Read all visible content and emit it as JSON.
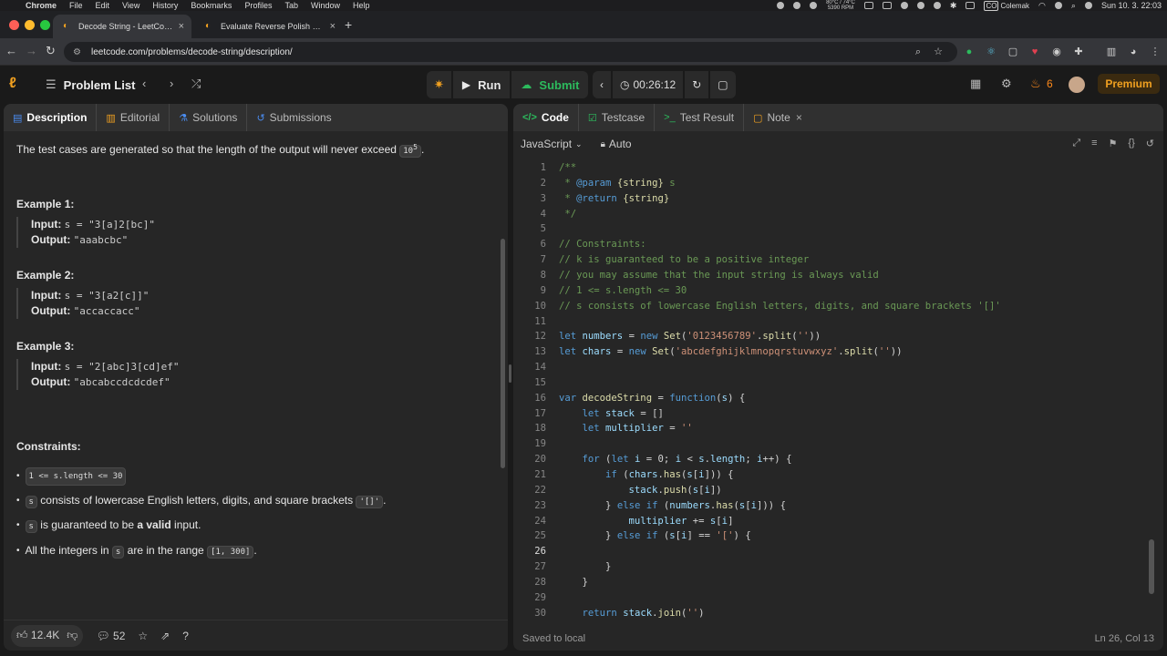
{
  "menubar": {
    "app": "Chrome",
    "items": [
      "File",
      "Edit",
      "View",
      "History",
      "Bookmarks",
      "Profiles",
      "Tab",
      "Window",
      "Help"
    ],
    "cpu_text": "80°C / 74°C",
    "fan_text": "5390 RPM",
    "keyboard": "Colemak",
    "clock": "Sun 10. 3.  22:03"
  },
  "tabs": [
    {
      "title": "Decode String - LeetCode",
      "active": true
    },
    {
      "title": "Evaluate Reverse Polish Notat",
      "active": false
    }
  ],
  "address": {
    "url": "leetcode.com/problems/decode-string/description/"
  },
  "header": {
    "problem_list": "Problem List",
    "run_label": "Run",
    "submit_label": "Submit",
    "timer": "00:26:12",
    "streak": "6",
    "premium": "Premium"
  },
  "left_tabs": [
    "Description",
    "Editorial",
    "Solutions",
    "Submissions"
  ],
  "description": {
    "intro_pre": "The test cases are generated so that the length of the output will never exceed ",
    "intro_code": "10",
    "intro_sup": "5",
    "intro_post": ".",
    "examples": [
      {
        "title": "Example 1:",
        "input": "s = \"3[a]2[bc]\"",
        "output": "\"aaabcbc\""
      },
      {
        "title": "Example 2:",
        "input": "s = \"3[a2[c]]\"",
        "output": "\"accaccacc\""
      },
      {
        "title": "Example 3:",
        "input": "s = \"2[abc]3[cd]ef\"",
        "output": "\"abcabccdcdcdef\""
      }
    ],
    "input_label": "Input:",
    "output_label": "Output:",
    "constraints_title": "Constraints:",
    "constraints": {
      "c1_code": "1 <= s.length <= 30",
      "c2_code": "s",
      "c2_text": " consists of lowercase English letters, digits, and square brackets ",
      "c2_code2": "'[]'",
      "c2_end": ".",
      "c3_code": "s",
      "c3_text": " is guaranteed to be ",
      "c3_bold": "a valid",
      "c3_end": " input.",
      "c4_text": "All the integers in ",
      "c4_code": "s",
      "c4_mid": " are in the range ",
      "c4_code2": "[1, 300]",
      "c4_end": "."
    },
    "likes": "12.4K",
    "comments": "52"
  },
  "right_tabs": [
    "Code",
    "Testcase",
    "Test Result",
    "Note"
  ],
  "editor": {
    "language": "JavaScript",
    "mode": "Auto",
    "saved": "Saved to local",
    "cursor": "Ln 26, Col 13",
    "current_line": 26,
    "lines": [
      "/**",
      " * @param {string} s",
      " * @return {string}",
      " */",
      "",
      "// Constraints:",
      "// k is guaranteed to be a positive integer",
      "// you may assume that the input string is always valid",
      "// 1 <= s.length <= 30",
      "// s consists of lowercase English letters, digits, and square brackets '[]'",
      "",
      "let numbers = new Set('0123456789'.split(''))",
      "let chars = new Set('abcdefghijklmnopqrstuvwxyz'.split(''))",
      "",
      "",
      "var decodeString = function(s) {",
      "    let stack = []",
      "    let multiplier = ''",
      "",
      "    for (let i = 0; i < s.length; i++) {",
      "        if (chars.has(s[i])) {",
      "            stack.push(s[i])",
      "        } else if (numbers.has(s[i])) {",
      "            multiplier += s[i]",
      "        } else if (s[i] == '[') {",
      "",
      "        }",
      "    }",
      "",
      "    return stack.join('')"
    ]
  }
}
